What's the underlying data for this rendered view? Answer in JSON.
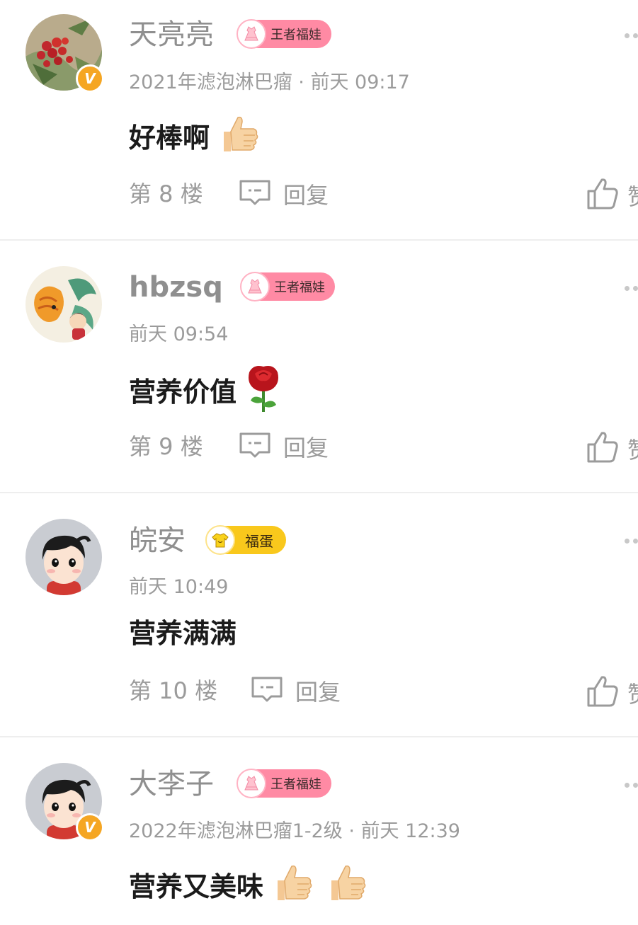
{
  "colors": {
    "name": "#8f8f8f",
    "meta": "#9b9b9b",
    "text": "#1b1b1b",
    "badge_pink": "#ff8aa4",
    "badge_yellow": "#f9c81c",
    "vip": "#f5a623"
  },
  "comments": [
    {
      "name": "天亮亮",
      "badge": "王者福娃",
      "meta": "2021年滤泡淋巴瘤 · 前天 09:17",
      "text": "好棒啊",
      "emoji": [
        "thumbs-up"
      ],
      "floor": "第 8 楼",
      "reply": "回复",
      "like": "赞",
      "verified": true
    },
    {
      "name": "hbzsq",
      "badge": "王者福娃",
      "meta": "前天 09:54",
      "text": "营养价值",
      "emoji": [
        "rose"
      ],
      "floor": "第 9 楼",
      "reply": "回复",
      "like": "赞",
      "verified": false
    },
    {
      "name": "皖安",
      "badge": "福蛋",
      "meta": "前天 10:49",
      "text": "营养满满",
      "emoji": [],
      "floor": "第 10 楼",
      "reply": "回复",
      "like": "赞",
      "verified": false
    },
    {
      "name": "大李子",
      "badge": "王者福娃",
      "meta": "2022年滤泡淋巴瘤1-2级 · 前天 12:39",
      "text": "营养又美味",
      "emoji": [
        "thumbs-up",
        "thumbs-up"
      ],
      "verified": true
    }
  ]
}
